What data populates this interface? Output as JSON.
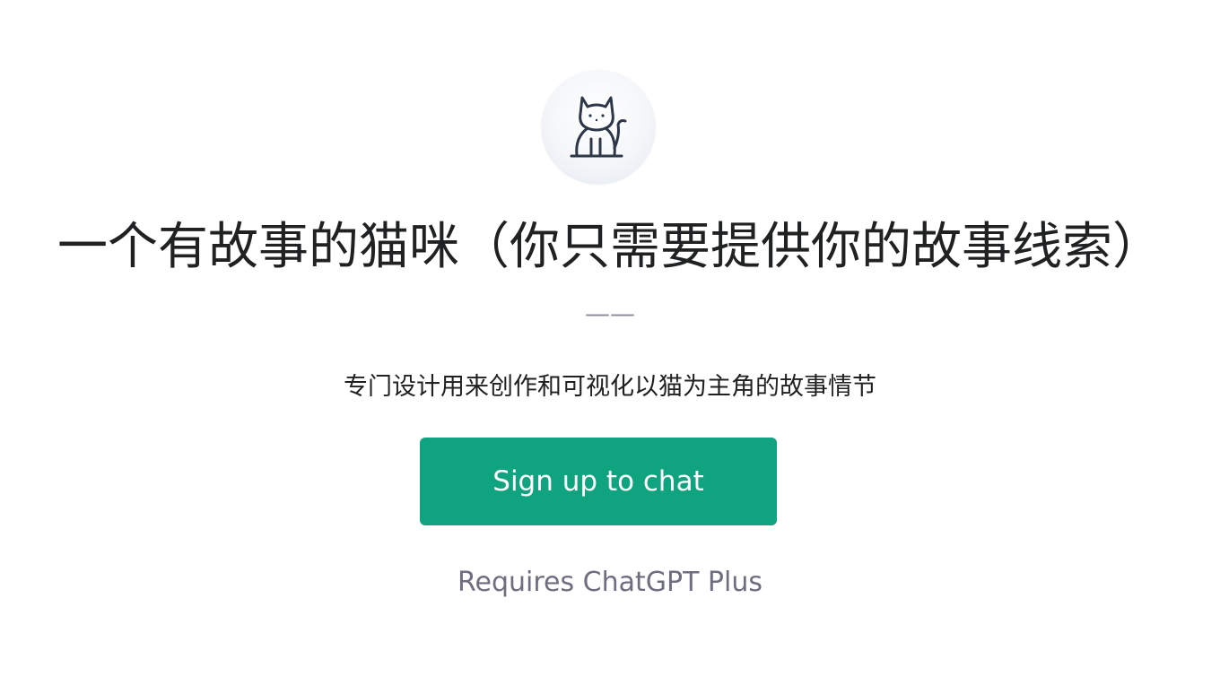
{
  "gpt": {
    "icon": "cat-icon",
    "title": "一个有故事的猫咪（你只需要提供你的故事线索）",
    "title_continuation": "——",
    "description": "专门设计用来创作和可视化以猫为主角的故事情节"
  },
  "cta": {
    "signup_label": "Sign up to chat",
    "requirement_note": "Requires ChatGPT Plus"
  },
  "colors": {
    "accent": "#10a37f",
    "text_primary": "#202123",
    "text_muted": "#6e6e80"
  }
}
